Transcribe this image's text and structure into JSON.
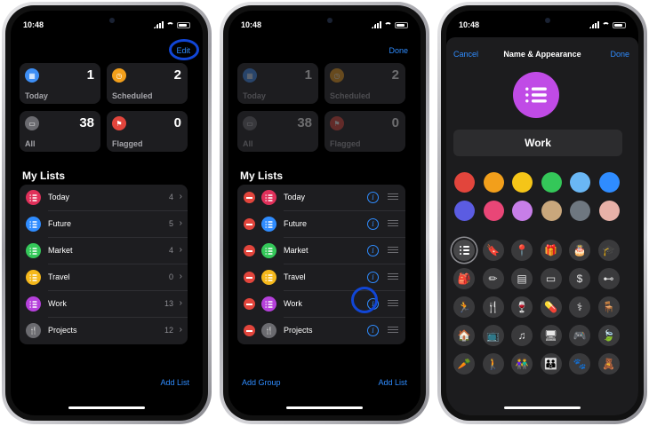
{
  "status": {
    "time": "10:48"
  },
  "phone1": {
    "nav_edit": "Edit",
    "cards": [
      {
        "label": "Today",
        "count": "1",
        "color": "#3d8ef5",
        "icon": "calendar-icon"
      },
      {
        "label": "Scheduled",
        "count": "2",
        "color": "#f29f1b",
        "icon": "clock-icon"
      },
      {
        "label": "All",
        "count": "38",
        "color": "#6b6b70",
        "icon": "tray-icon"
      },
      {
        "label": "Flagged",
        "count": "0",
        "color": "#e2453c",
        "icon": "flag-icon"
      }
    ],
    "section_title": "My Lists",
    "lists": [
      {
        "name": "Today",
        "count": "4",
        "color": "#e0305a",
        "icon": "list-bullet-icon"
      },
      {
        "name": "Future",
        "count": "5",
        "color": "#2f8cff",
        "icon": "list-bullet-icon"
      },
      {
        "name": "Market",
        "count": "4",
        "color": "#34c759",
        "icon": "list-bullet-icon"
      },
      {
        "name": "Travel",
        "count": "0",
        "color": "#f5b81b",
        "icon": "list-bullet-icon"
      },
      {
        "name": "Work",
        "count": "13",
        "color": "#b540db",
        "icon": "list-bullet-icon"
      },
      {
        "name": "Projects",
        "count": "12",
        "color": "#6b6b70",
        "icon": "fork-knife-icon"
      }
    ],
    "add_list": "Add List"
  },
  "phone2": {
    "nav_done": "Done",
    "cards": [
      {
        "label": "Today",
        "count": "1",
        "color": "#3d8ef5",
        "icon": "calendar-icon"
      },
      {
        "label": "Scheduled",
        "count": "2",
        "color": "#f29f1b",
        "icon": "clock-icon"
      },
      {
        "label": "All",
        "count": "38",
        "color": "#6b6b70",
        "icon": "tray-icon"
      },
      {
        "label": "Flagged",
        "count": "0",
        "color": "#e2453c",
        "icon": "flag-icon"
      }
    ],
    "section_title": "My Lists",
    "lists": [
      {
        "name": "Today",
        "color": "#e0305a"
      },
      {
        "name": "Future",
        "color": "#2f8cff"
      },
      {
        "name": "Market",
        "color": "#34c759"
      },
      {
        "name": "Travel",
        "color": "#f5b81b"
      },
      {
        "name": "Work",
        "color": "#b540db"
      },
      {
        "name": "Projects",
        "color": "#6b6b70"
      }
    ],
    "add_group": "Add Group",
    "add_list": "Add List"
  },
  "phone3": {
    "cancel": "Cancel",
    "title": "Name & Appearance",
    "done": "Done",
    "list_name": "Work",
    "icon_color": "#c04be6",
    "colors": [
      "#e2453c",
      "#f29f1b",
      "#f5c518",
      "#34c759",
      "#6ab7f5",
      "#2f8cff",
      "#5b5ce2",
      "#e94677",
      "#c77ee8",
      "#c9a77c",
      "#6e7780",
      "#e7b1a8"
    ],
    "glyphs": [
      {
        "name": "list-bullet-icon",
        "ch": ""
      },
      {
        "name": "bookmark-icon",
        "ch": "🔖"
      },
      {
        "name": "pin-icon",
        "ch": "📍"
      },
      {
        "name": "gift-icon",
        "ch": "🎁"
      },
      {
        "name": "cake-icon",
        "ch": "🎂"
      },
      {
        "name": "graduation-cap-icon",
        "ch": "🎓"
      },
      {
        "name": "backpack-icon",
        "ch": "🎒"
      },
      {
        "name": "ruler-pencil-icon",
        "ch": "✏"
      },
      {
        "name": "document-icon",
        "ch": "▤"
      },
      {
        "name": "credit-card-icon",
        "ch": "▭"
      },
      {
        "name": "money-icon",
        "ch": "$"
      },
      {
        "name": "dumbbell-icon",
        "ch": "⊷"
      },
      {
        "name": "running-icon",
        "ch": "🏃"
      },
      {
        "name": "fork-knife-icon",
        "ch": "🍴"
      },
      {
        "name": "wine-glass-icon",
        "ch": "🍷"
      },
      {
        "name": "pills-icon",
        "ch": "💊"
      },
      {
        "name": "stethoscope-icon",
        "ch": "⚕"
      },
      {
        "name": "chair-icon",
        "ch": "🪑"
      },
      {
        "name": "house-icon",
        "ch": "🏠"
      },
      {
        "name": "tv-icon",
        "ch": "📺"
      },
      {
        "name": "music-note-icon",
        "ch": "♫"
      },
      {
        "name": "computer-icon",
        "ch": "🖥"
      },
      {
        "name": "gamecontroller-icon",
        "ch": "🎮"
      },
      {
        "name": "leaf-icon",
        "ch": "🍃"
      },
      {
        "name": "carrot-icon",
        "ch": "🥕"
      },
      {
        "name": "person-icon",
        "ch": "🚶"
      },
      {
        "name": "two-people-icon",
        "ch": "👫"
      },
      {
        "name": "family-icon",
        "ch": "👪"
      },
      {
        "name": "paw-icon",
        "ch": "🐾"
      },
      {
        "name": "teddy-bear-icon",
        "ch": "🧸"
      }
    ]
  }
}
